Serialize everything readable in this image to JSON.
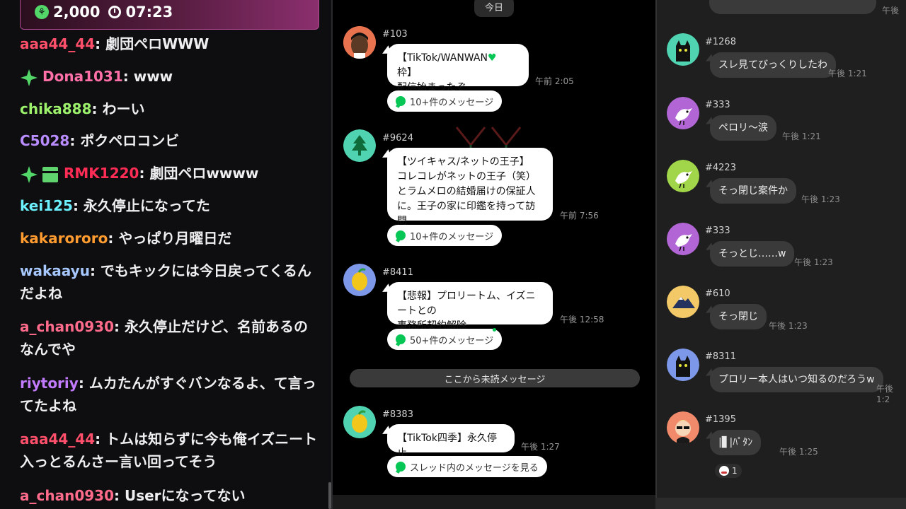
{
  "pinned": {
    "coins": "2,000",
    "timer": "07:23"
  },
  "chat": [
    {
      "user": "aaa44_44",
      "color": "#ff4f6a",
      "sep": ": ",
      "text": "劇団ペロWWW",
      "badges": []
    },
    {
      "user": "Dona1031",
      "color": "#ff6fa8",
      "sep": ": ",
      "text": "www",
      "badges": [
        "star"
      ]
    },
    {
      "user": "chika888",
      "color": "#9cf26b",
      "sep": ": ",
      "text": "わーい",
      "badges": []
    },
    {
      "user": "C5028",
      "color": "#b98cff",
      "sep": ": ",
      "text": "ポクペロコンビ",
      "badges": []
    },
    {
      "user": "RMK1220",
      "color": "#ff2d55",
      "sep": ": ",
      "text": "劇団ペロwwww",
      "badges": [
        "star",
        "gift"
      ]
    },
    {
      "user": "kei125",
      "color": "#6cf0ff",
      "sep": ": ",
      "text": "永久停止になってた",
      "badges": []
    },
    {
      "user": "kakarororo",
      "color": "#ff9b2f",
      "sep": ": ",
      "text": "やっぱり月曜日だ",
      "badges": []
    },
    {
      "user": "wakaayu",
      "color": "#a7c8ff",
      "sep": ": ",
      "text": "でもキックには今日戻ってくるんだよね",
      "badges": []
    },
    {
      "user": "a_chan0930",
      "color": "#ff6b8b",
      "sep": ": ",
      "text": "永久停止だけど、名前あるのなんでや",
      "badges": []
    },
    {
      "user": "riytoriy",
      "color": "#c27bff",
      "sep": ": ",
      "text": "ムカたんがすぐバンなるよ、て言ってたよね",
      "badges": []
    },
    {
      "user": "aaa44_44",
      "color": "#ff4f6a",
      "sep": ": ",
      "text": "トムは知らずに今も俺イズニート入っとるんさー言い回ってそう",
      "badges": []
    },
    {
      "user": "a_chan0930",
      "color": "#ff6b8b",
      "sep": ": ",
      "text": "Userになってない",
      "badges": []
    }
  ],
  "middle": {
    "date_label": "今日",
    "unread_label": "ここから未読メッセージ",
    "messages": [
      {
        "id": "#103",
        "lines": [
          "【TikTok/WANWAN",
          "配信始まったぞ"
        ],
        "heart_line_suffix": " 枠】",
        "time": "午前 2:05",
        "button": "10+件のメッセージ",
        "avatar": "man"
      },
      {
        "id": "#9624",
        "lines": [
          "【ツイキャス/ネットの王子】",
          "コレコレがネットの王子（笑）",
          "とラムメロの結婚届けの保証人",
          "に。王子の家に印鑑を持って訪問"
        ],
        "time": "午前 7:56",
        "button": "10+件のメッセージ",
        "avatar": "tree"
      },
      {
        "id": "#8411",
        "lines": [
          "【悲報】プロリートム、イズニートとの",
          "事務所契約解除"
        ],
        "time": "午後 12:58",
        "button": "50+件のメッセージ",
        "avatar": "lemon-blue"
      },
      {
        "id": "#8383",
        "lines": [
          "【TikTok四季】永久停止"
        ],
        "time": "午後 1:27",
        "button": "スレッド内のメッセージを見る",
        "avatar": "lemon-green"
      }
    ]
  },
  "right": {
    "messages": [
      {
        "id": "#1268",
        "text": "スレ見てびっくりしたわ",
        "time": "午後 1:21",
        "avatar": "cat-green"
      },
      {
        "id": "#333",
        "text": "ペロリ〜涙",
        "time": "午後 1:21",
        "avatar": "bird-purple"
      },
      {
        "id": "#4223",
        "text": "そっ閉じ案件か",
        "time": "午後 1:23",
        "avatar": "bird-green"
      },
      {
        "id": "#333",
        "text": "そっとじ……w",
        "time": "午後 1:23",
        "avatar": "bird-purple"
      },
      {
        "id": "#610",
        "text": "そっ閉じ",
        "time": "午後 1:23",
        "avatar": "mountain"
      },
      {
        "id": "#8311",
        "text": "プロリー本人はいつ知るのだろうw",
        "time": "午後 1:2",
        "avatar": "cat-blue"
      },
      {
        "id": "#1395",
        "text": "|▋|ﾊﾟﾀﾝ",
        "time": "午後 1:25",
        "avatar": "sunglasses"
      }
    ],
    "reaction_count": "1",
    "partial_time": "午後"
  }
}
